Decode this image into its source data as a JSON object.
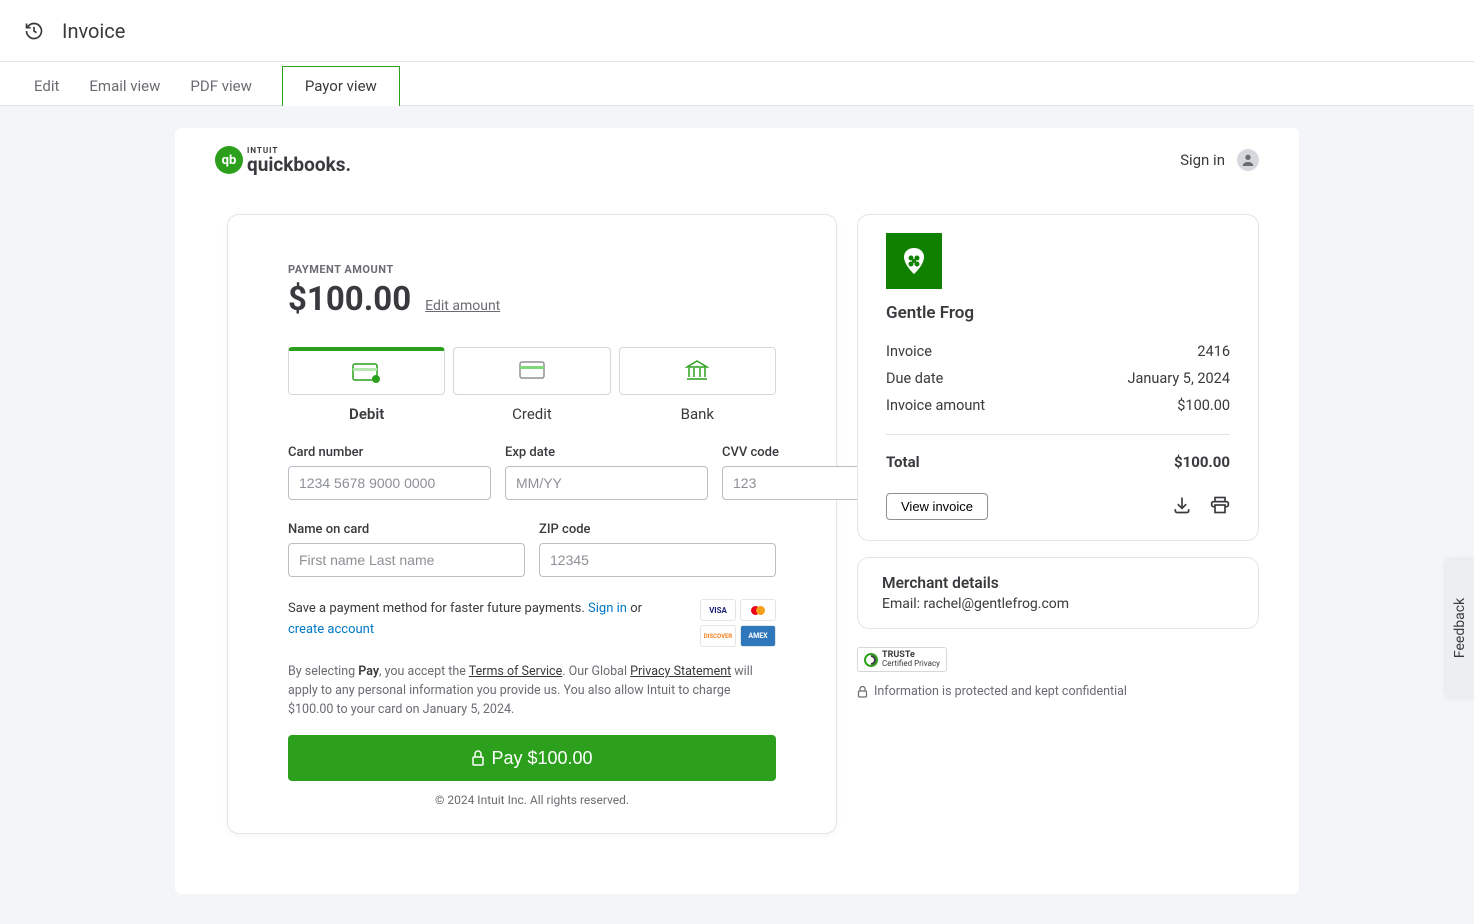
{
  "header": {
    "title": "Invoice"
  },
  "tabs": {
    "edit": "Edit",
    "email": "Email view",
    "pdf": "PDF view",
    "payor": "Payor view"
  },
  "brand": {
    "intuit": "INTUIT",
    "name": "quickbooks."
  },
  "signin": "Sign in",
  "payment": {
    "label": "PAYMENT AMOUNT",
    "amount": "$100.00",
    "edit": "Edit amount",
    "methods": {
      "debit": "Debit",
      "credit": "Credit",
      "bank": "Bank"
    },
    "fields": {
      "card_number": {
        "label": "Card number",
        "placeholder": "1234 5678 9000 0000"
      },
      "exp": {
        "label": "Exp date",
        "placeholder": "MM/YY"
      },
      "cvv": {
        "label": "CVV code",
        "placeholder": "123"
      },
      "name": {
        "label": "Name on card",
        "placeholder": "First name Last name"
      },
      "zip": {
        "label": "ZIP code",
        "placeholder": "12345"
      }
    },
    "save_text": "Save a payment method for faster future payments. ",
    "signin_link": "Sign in",
    "or": " or ",
    "create_link": "create account",
    "legal_pre": "By selecting ",
    "legal_bold": "Pay",
    "legal_mid1": ", you accept the ",
    "tos": "Terms of Service",
    "legal_mid2": ". Our Global ",
    "privacy": "Privacy Statement",
    "legal_post": " will apply to any personal information you provide us. You also allow Intuit to charge $100.00 to your card on January 5, 2024.",
    "pay_button": "Pay  $100.00",
    "copyright": "© 2024 Intuit Inc. All rights reserved.",
    "card_brands": {
      "visa": "VISA",
      "mc": "●●",
      "discover": "DISCOVER",
      "amex": "AMEX"
    }
  },
  "summary": {
    "merchant": "Gentle Frog",
    "rows": {
      "invoice_label": "Invoice",
      "invoice_value": "2416",
      "due_label": "Due date",
      "due_value": "January 5, 2024",
      "amount_label": "Invoice amount",
      "amount_value": "$100.00"
    },
    "total_label": "Total",
    "total_value": "$100.00",
    "view_invoice": "View invoice"
  },
  "merchant_details": {
    "title": "Merchant details",
    "email": "Email: rachel@gentlefrog.com"
  },
  "truste": {
    "brand": "TRUSTe",
    "sub": "Certified Privacy"
  },
  "confidential": "Information is protected and kept confidential",
  "feedback": "Feedback"
}
